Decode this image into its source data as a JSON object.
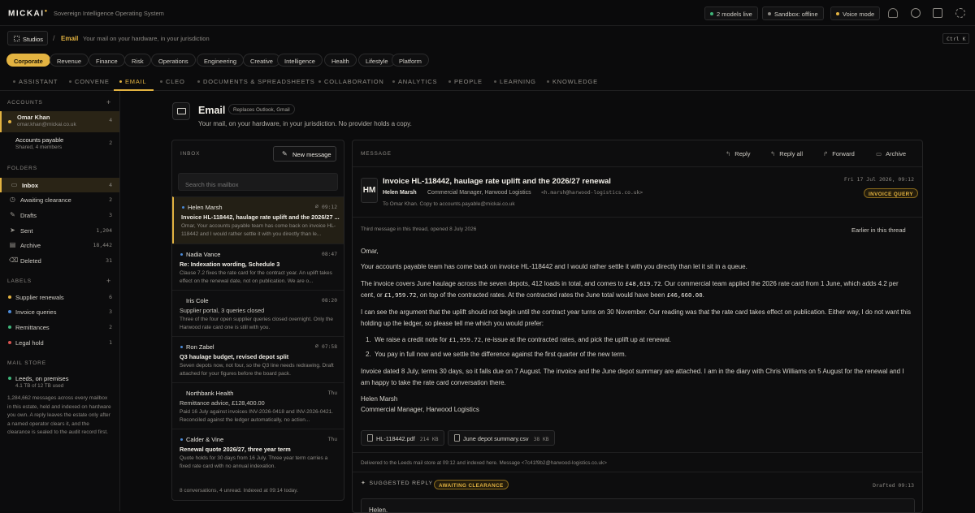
{
  "app": {
    "logo": "MICKAI",
    "tagline": "Sovereign Intelligence Operating System"
  },
  "top": {
    "models": "2 models live",
    "sandbox": "Sandbox: offline",
    "voice": "Voice mode"
  },
  "nav": {
    "studios": "Studios",
    "section": "Email",
    "sub": "Your mail on your hardware, in your jurisdiction",
    "shortcut": "Ctrl K"
  },
  "chips": [
    "Corporate",
    "Revenue",
    "Finance",
    "Risk",
    "Operations",
    "Engineering",
    "Creative",
    "Intelligence",
    "Health",
    "Lifestyle",
    "Platform"
  ],
  "tabs": [
    "ASSISTANT",
    "CONVENE",
    "EMAIL",
    "CLEO",
    "DOCUMENTS & SPREADSHEETS",
    "COLLABORATION",
    "ANALYTICS",
    "PEOPLE",
    "LEARNING",
    "KNOWLEDGE"
  ],
  "sidebar": {
    "accounts_title": "ACCOUNTS",
    "accounts": [
      {
        "name": "Omar Khan",
        "sub": "omar.khan@mickai.co.uk",
        "count": "4"
      },
      {
        "name": "Accounts payable",
        "sub": "Shared, 4 members",
        "count": "2"
      }
    ],
    "folders_title": "FOLDERS",
    "folders": [
      {
        "label": "Inbox",
        "count": "4"
      },
      {
        "label": "Awaiting clearance",
        "count": "2"
      },
      {
        "label": "Drafts",
        "count": "3"
      },
      {
        "label": "Sent",
        "count": "1,204"
      },
      {
        "label": "Archive",
        "count": "18,442"
      },
      {
        "label": "Deleted",
        "count": "31"
      }
    ],
    "labels_title": "LABELS",
    "labels": [
      {
        "label": "Supplier renewals",
        "count": "6",
        "color": "#e3b341"
      },
      {
        "label": "Invoice queries",
        "count": "3",
        "color": "#4c8bd8"
      },
      {
        "label": "Remittances",
        "count": "2",
        "color": "#3fb67a"
      },
      {
        "label": "Legal hold",
        "count": "1",
        "color": "#d9534f"
      }
    ],
    "store_title": "MAIL STORE",
    "store_name": "Leeds, on premises",
    "store_usage": "4.1 TB of 12 TB used",
    "store_note": "1,284,662 messages across every mailbox in this estate, held and indexed on hardware you own. A reply leaves the estate only after a named operator clears it, and the clearance is sealed to the audit record first."
  },
  "header": {
    "title": "Email",
    "replaces": "Replaces Outlook, Gmail",
    "sub": "Your mail, on your hardware, in your jurisdiction. No provider holds a copy."
  },
  "inbox": {
    "title": "INBOX",
    "new_message": "New message",
    "search_placeholder": "Search this mailbox",
    "messages": [
      {
        "from": "Helen Marsh",
        "time": "09:12",
        "subject": "Invoice HL-118442, haulage rate uplift and the 2026/27 ...",
        "preview": "Omar, Your accounts payable team has come back on invoice HL-118442 and I would rather settle it with you directly than le..."
      },
      {
        "from": "Nadia Vance",
        "time": "08:47",
        "subject": "Re: Indexation wording, Schedule 3",
        "preview": "Clause 7.2 fixes the rate card for the contract year. An uplift takes effect on the renewal date, not on publication. We are o..."
      },
      {
        "from": "Iris Cole",
        "time": "08:20",
        "subject": "Supplier portal, 3 queries closed",
        "preview": "Three of the four open supplier queries closed overnight. Only the Harwood rate card one is still with you."
      },
      {
        "from": "Ron Zabel",
        "time": "07:58",
        "subject": "Q3 haulage budget, revised depot split",
        "preview": "Seven depots now, not four, so the Q3 line needs redrawing. Draft attached for your figures before the board pack."
      },
      {
        "from": "Northbank Health",
        "time": "Thu",
        "subject": "Remittance advice, £128,400.00",
        "preview": "Paid 16 July against invoices INV-2026-0418 and INV-2026-0421. Reconciled against the ledger automatically, no action..."
      },
      {
        "from": "Calder & Vine",
        "time": "Thu",
        "subject": "Renewal quote 2026/27, three year term",
        "preview": "Quote holds for 30 days from 16 July. Three year term carries a fixed rate card with no annual indexation."
      }
    ],
    "footer": "8 conversations, 4 unread. Indexed at 09:14 today."
  },
  "message": {
    "title": "MESSAGE",
    "actions": [
      "Reply",
      "Reply all",
      "Forward",
      "Archive"
    ],
    "avatar": "HM",
    "subject": "Invoice HL-118442, haulage rate uplift and the 2026/27 renewal",
    "from": "Helen Marsh",
    "role": "Commercial Manager, Harwood Logistics",
    "address": "<h.marsh@harwood-logistics.co.uk>",
    "to": "To Omar Khan. Copy to accounts.payable@mickai.co.uk",
    "date": "Fri 17 Jul 2026, 09:12",
    "badge": "INVOICE QUERY",
    "thread": "Third message in this thread, opened 8 July 2026",
    "earlier": "Earlier in this thread",
    "greeting": "Omar,",
    "p1": "Your accounts payable team has come back on invoice HL-118442 and I would rather settle it with you directly than let it sit in a queue.",
    "p2a": "The invoice covers June haulage across the seven depots, 412 loads in total, and comes to ",
    "p2b": "£48,619.72",
    "p2c": ". Our commercial team applied the 2026 rate card from 1 June, which adds 4.2 per cent, or ",
    "p2d": "£1,959.72",
    "p2e": ", on top of the contracted rates. At the contracted rates the June total would have been ",
    "p2f": "£46,660.00",
    "p2g": ".",
    "p3": "I can see the argument that the uplift should not begin until the contract year turns on 30 November. Our reading was that the rate card takes effect on publication. Either way, I do not want this holding up the ledger, so please tell me which you would prefer:",
    "o1a": "We raise a credit note for ",
    "o1b": "£1,959.72",
    "o1c": ", re-issue at the contracted rates, and pick the uplift up at renewal.",
    "o2": "You pay in full now and we settle the difference against the first quarter of the new term.",
    "p4": "Invoice dated 8 July, terms 30 days, so it falls due on 7 August. The invoice and the June depot summary are attached. I am in the diary with Chris Williams on 5 August for the renewal and I am happy to take the rate card conversation there.",
    "sig_name": "Helen Marsh",
    "sig_role": "Commercial Manager, Harwood Logistics",
    "attachments": [
      {
        "name": "HL-118442.pdf",
        "size": "214 KB"
      },
      {
        "name": "June depot summary.csv",
        "size": "38 KB"
      }
    ],
    "delivered": "Delivered to the Leeds mail store at 09:12 and indexed here. Message <7c41f9b2@harwood-logistics.co.uk>",
    "suggested": "SUGGESTED REPLY",
    "awaiting": "AWAITING CLEARANCE",
    "drafted": "Drafted 09:13",
    "draft_start": "Helen,"
  },
  "colors": {
    "accent": "#e3b341",
    "unread": "#4c8bd8",
    "live": "#3fb67a"
  }
}
